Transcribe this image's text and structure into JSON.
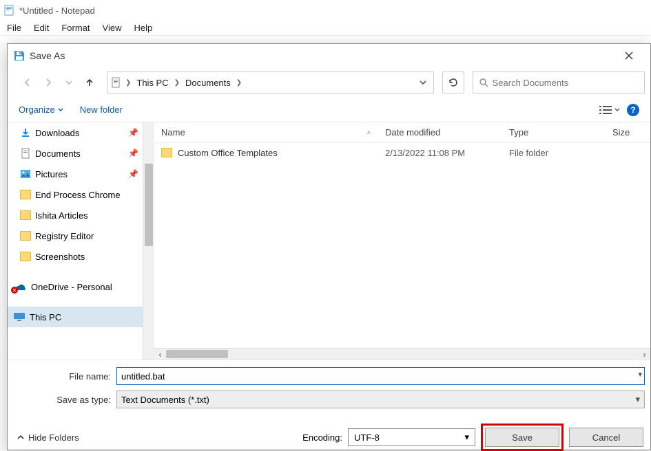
{
  "notepad": {
    "title": "*Untitled - Notepad",
    "menu": [
      "File",
      "Edit",
      "Format",
      "View",
      "Help"
    ]
  },
  "dialog": {
    "title": "Save As",
    "breadcrumb": {
      "root": "This PC",
      "folder": "Documents"
    },
    "search_placeholder": "Search Documents",
    "organize": "Organize",
    "new_folder": "New folder",
    "columns": {
      "name": "Name",
      "date": "Date modified",
      "type": "Type",
      "size": "Size"
    },
    "rows": [
      {
        "name": "Custom Office Templates",
        "date": "2/13/2022 11:08 PM",
        "type": "File folder",
        "size": ""
      }
    ],
    "nav": {
      "quick": [
        {
          "label": "Downloads",
          "icon": "download",
          "pinned": true
        },
        {
          "label": "Documents",
          "icon": "document",
          "pinned": true
        },
        {
          "label": "Pictures",
          "icon": "pictures",
          "pinned": true
        },
        {
          "label": "End Process Chrome",
          "icon": "folder",
          "pinned": false
        },
        {
          "label": "Ishita Articles",
          "icon": "folder",
          "pinned": false
        },
        {
          "label": "Registry Editor",
          "icon": "folder",
          "pinned": false
        },
        {
          "label": "Screenshots",
          "icon": "folder",
          "pinned": false
        }
      ],
      "onedrive": "OneDrive - Personal",
      "thispc": "This PC"
    },
    "filename_label": "File name:",
    "filename_value": "untitled.bat",
    "savetype_label": "Save as type:",
    "savetype_value": "Text Documents (*.txt)",
    "encoding_label": "Encoding:",
    "encoding_value": "UTF-8",
    "hide_folders": "Hide Folders",
    "save": "Save",
    "cancel": "Cancel"
  }
}
